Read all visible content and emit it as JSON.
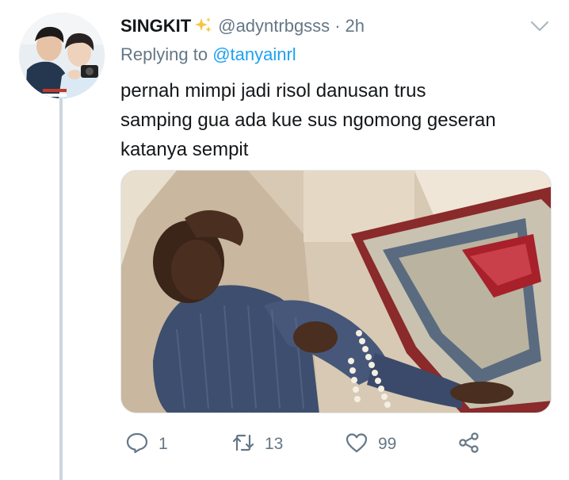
{
  "tweet": {
    "display_name": "SINGKIT",
    "handle": "@adyntrbgsss",
    "separator": "·",
    "time": "2h",
    "replying_prefix": "Replying to",
    "replying_to": "@tanyainrl",
    "text_lines": [
      "pernah mimpi jadi risol danusan trus",
      "samping gua ada kue sus ngomong geseran",
      "katanya sempit"
    ]
  },
  "actions": {
    "reply_count": "1",
    "retweet_count": "13",
    "like_count": "99"
  },
  "icons": {
    "sparkle": "sparkles-icon",
    "caret": "chevron-down-icon",
    "reply": "reply-icon",
    "retweet": "retweet-icon",
    "like": "heart-icon",
    "share": "share-icon"
  },
  "colors": {
    "accent": "#1da1f2",
    "secondary_text": "#657786",
    "primary_text": "#14171a",
    "sparkle": "#f5c542"
  }
}
